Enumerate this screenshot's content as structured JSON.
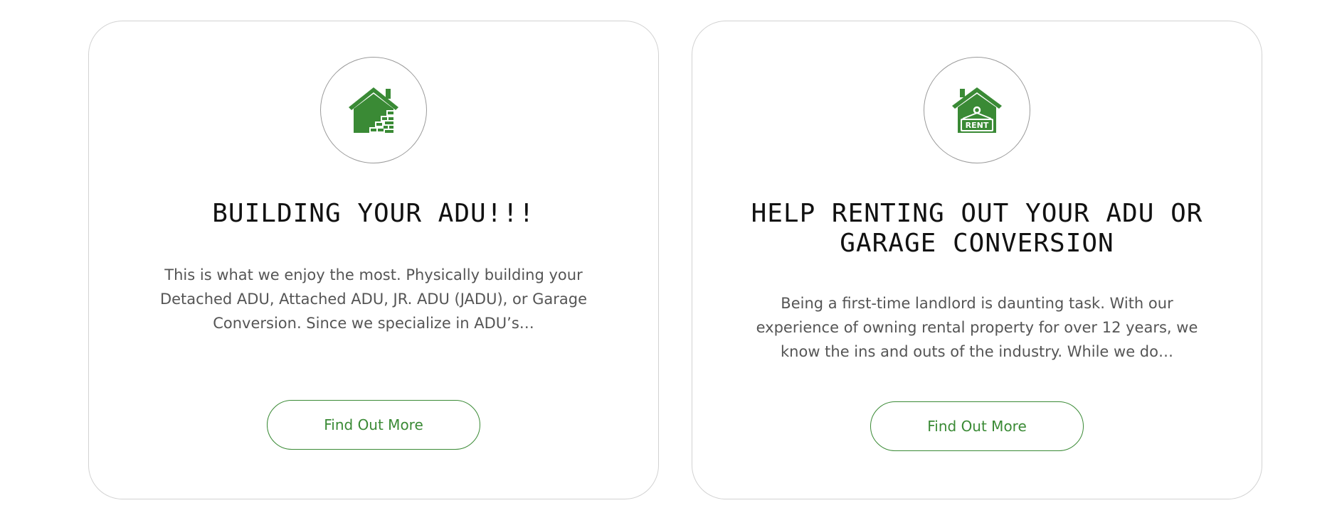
{
  "theme": {
    "accent": "#3a8a35",
    "title_color": "#111111",
    "text_color": "#555555",
    "card_border": "#d2d2d2"
  },
  "cards": [
    {
      "icon": "house-bricks-icon",
      "title": "BUILDING YOUR ADU!!!",
      "description": "This is what we enjoy the most.  Physically building your Detached ADU, Attached ADU, JR. ADU (JADU), or Garage Conversion.  Since we specialize in ADU’s…",
      "button_label": "Find Out More"
    },
    {
      "icon": "house-rent-sign-icon",
      "icon_text": "RENT",
      "title": "HELP RENTING OUT YOUR ADU OR GARAGE CONVERSION",
      "description": "Being a first-time landlord is daunting task.  With our experience of owning rental property for over 12 years, we know the ins and outs of the industry.  While we do…",
      "button_label": "Find Out More"
    }
  ]
}
